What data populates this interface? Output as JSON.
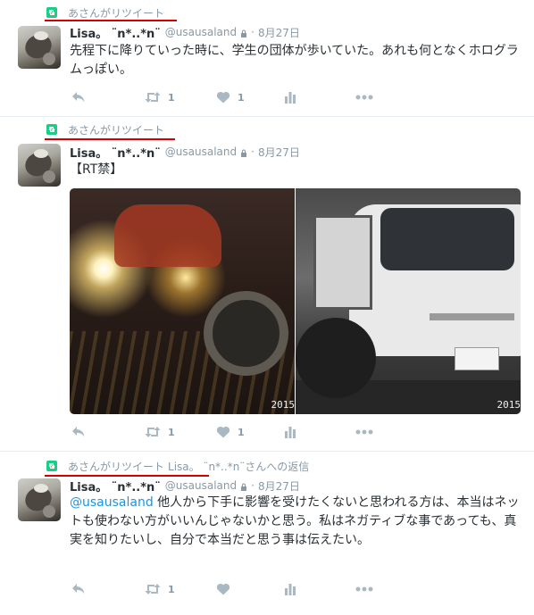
{
  "colors": {
    "text": "#292f33",
    "muted": "#8899a6",
    "link": "#1b95e0",
    "retweet_green": "#19cf86",
    "annotation_red": "#d40000",
    "divider": "#e6ecf0"
  },
  "tweets": [
    {
      "context": "あさんがリツイート",
      "context_reply": "",
      "fullname": "Lisa。 ¨n*..*n¨",
      "screen_name": "@usausaland",
      "time": "8月27日",
      "mention": "",
      "text": "先程下に降りていった時に、学生の団体が歩いていた。あれも何となくホログラムっぽい。",
      "photos": [],
      "actions": {
        "retweet_count": "1",
        "like_count": "1"
      }
    },
    {
      "context": "あさんがリツイート",
      "context_reply": "",
      "fullname": "Lisa。 ¨n*..*n¨",
      "screen_name": "@usausaland",
      "time": "8月27日",
      "mention": "",
      "text": "【RT禁】",
      "photos": [
        {
          "stamp": "2015",
          "icon": "night-car-photo"
        },
        {
          "stamp": "2015",
          "icon": "white-van-photo"
        }
      ],
      "actions": {
        "retweet_count": "1",
        "like_count": "1"
      }
    },
    {
      "context": "あさんがリツイート",
      "context_reply": "Lisa。 ¨n*..*n¨さんへの返信",
      "fullname": "Lisa。 ¨n*..*n¨",
      "screen_name": "@usausaland",
      "time": "8月27日",
      "mention": "@usausaland",
      "text": " 他人から下手に影響を受けたくないと思われる方は、本当はネットも使わない方がいいんじゃないかと思う。私はネガティブな事であっても、真実を知りたいし、自分で本当だと思う事は伝えたい。",
      "photos": [],
      "actions": {
        "retweet_count": "1",
        "like_count": ""
      }
    }
  ]
}
